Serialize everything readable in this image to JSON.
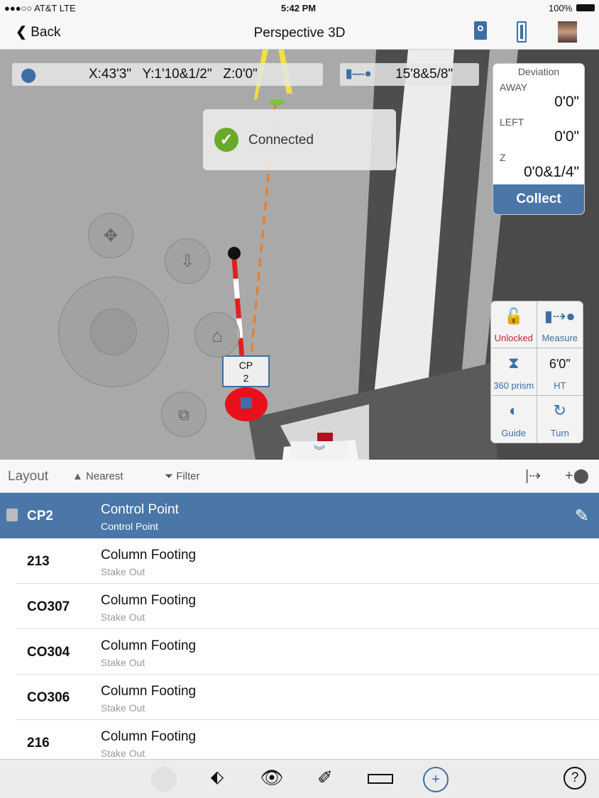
{
  "status_bar": {
    "carrier": "●●●○○ AT&T  LTE",
    "time": "5:42 PM",
    "battery": "100%"
  },
  "nav": {
    "back_label": "Back",
    "title": "Perspective 3D",
    "icons": [
      "instrument-icon",
      "battery-device-icon",
      "user-avatar"
    ]
  },
  "map": {
    "coordinates": "X:43'3\"   Y:1'10&1/2\"   Z:0'0\"",
    "distance": "15'8&5/8\"",
    "toast": "Connected",
    "point_label_line1": "CP",
    "point_label_line2": "2",
    "deviation": {
      "title": "Deviation",
      "away_label": "AWAY",
      "away_value": "0'0\"",
      "left_label": "LEFT",
      "left_value": "0'0\"",
      "z_label": "Z",
      "z_value": "0'0&1/4\"",
      "collect_label": "Collect"
    },
    "tools": {
      "unlocked": "Unlocked",
      "measure": "Measure",
      "prism": "360 prism",
      "ht_value": "6'0\"",
      "ht_label": "HT",
      "guide": "Guide",
      "turn": "Turn"
    },
    "colors": {
      "unlocked": "#c8202a",
      "accent": "#4a76a8",
      "success": "#6aaa2a"
    }
  },
  "list_toolbar": {
    "title": "Layout",
    "nearest": "Nearest",
    "filter": "Filter"
  },
  "points": [
    {
      "id": "CP2",
      "name": "Control Point",
      "type": "Control Point",
      "selected": true
    },
    {
      "id": "213",
      "name": "Column Footing",
      "type": "Stake Out"
    },
    {
      "id": "CO307",
      "name": "Column Footing",
      "type": "Stake Out"
    },
    {
      "id": "CO304",
      "name": "Column Footing",
      "type": "Stake Out"
    },
    {
      "id": "CO306",
      "name": "Column Footing",
      "type": "Stake Out"
    },
    {
      "id": "216",
      "name": "Column Footing",
      "type": "Stake Out"
    }
  ],
  "bottom_toolbar": {
    "help": "?"
  }
}
